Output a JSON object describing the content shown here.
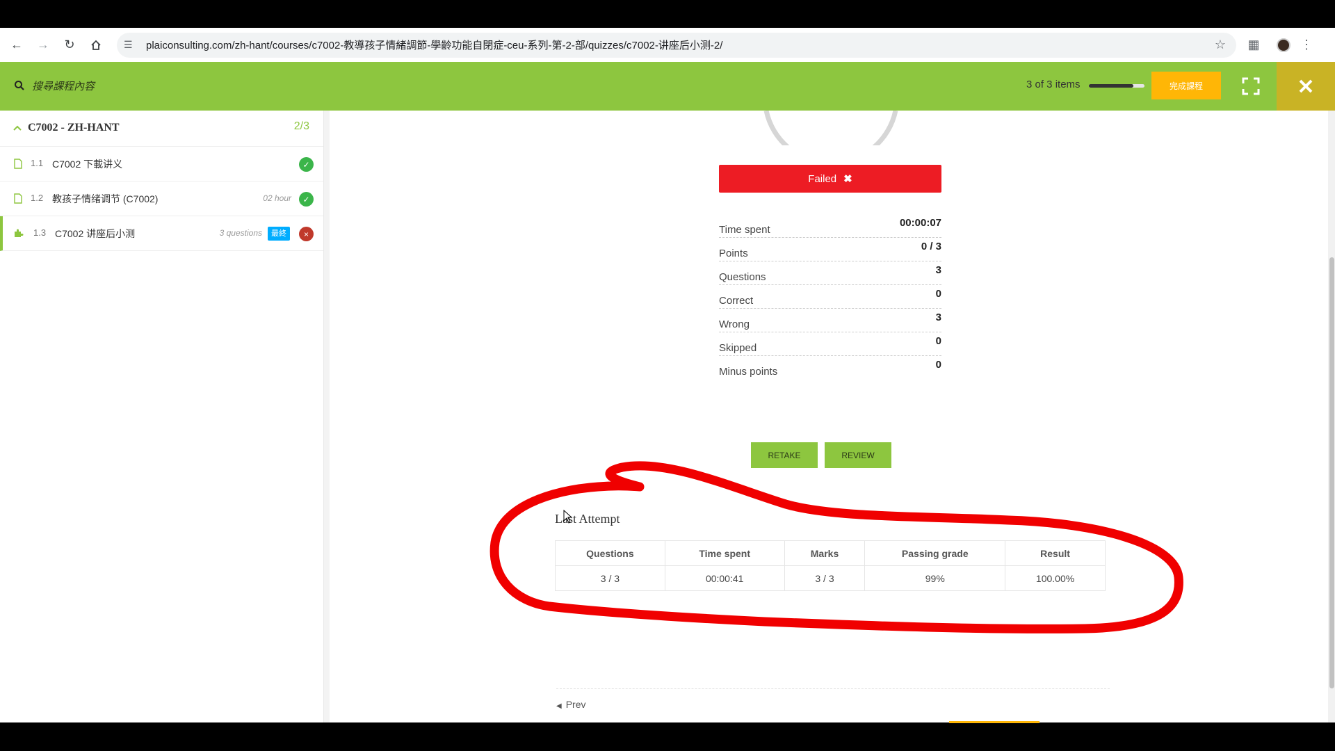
{
  "browser": {
    "url": "plaiconsulting.com/zh-hant/courses/c7002-教導孩子情緒調節-學齡功能自閉症-ceu-系列-第-2-部/quizzes/c7002-讲座后小测-2/"
  },
  "header": {
    "search_placeholder": "搜尋課程內容",
    "items_count": "3 of 3 items",
    "progress_fraction": 0.8,
    "finish_label": "完成課程",
    "accent_color": "#8dc63f"
  },
  "sidebar": {
    "section_title": "C7002 - ZH-HANT",
    "section_count": "2/3",
    "lessons": [
      {
        "num": "1.1",
        "name": "C7002 下載讲义",
        "meta": "",
        "status": "completed"
      },
      {
        "num": "1.2",
        "name": "教孩子情绪调节 (C7002)",
        "meta": "02 hour",
        "status": "completed"
      },
      {
        "num": "1.3",
        "name": "C7002 讲座后小测",
        "meta": "3 questions",
        "badge": "最終",
        "status": "failed"
      }
    ]
  },
  "quiz": {
    "result_label": "Failed",
    "result_color": "#ed1c24",
    "stats": [
      {
        "label": "Time spent",
        "value": "00:00:07"
      },
      {
        "label": "Points",
        "value": "0 / 3"
      },
      {
        "label": "Questions",
        "value": "3"
      },
      {
        "label": "Correct",
        "value": "0"
      },
      {
        "label": "Wrong",
        "value": "3"
      },
      {
        "label": "Skipped",
        "value": "0"
      },
      {
        "label": "Minus points",
        "value": "0"
      }
    ],
    "retake_label": "RETAKE",
    "review_label": "REVIEW"
  },
  "last_attempt": {
    "title": "Last Attempt",
    "headers": [
      "Questions",
      "Time spent",
      "Marks",
      "Passing grade",
      "Result"
    ],
    "row": [
      "3 / 3",
      "00:00:41",
      "3 / 3",
      "99%",
      "100.00%"
    ]
  },
  "footer": {
    "prev_label": "Prev"
  }
}
